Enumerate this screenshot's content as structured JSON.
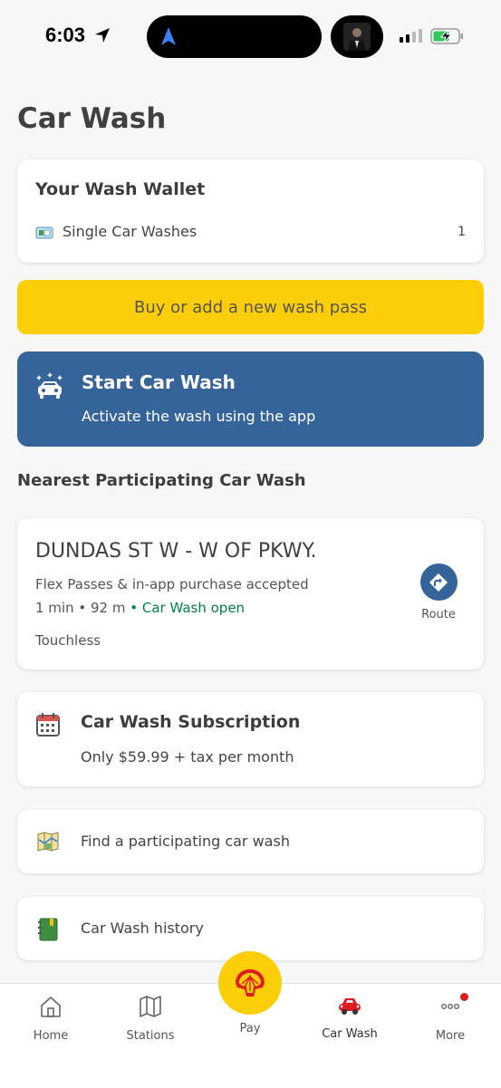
{
  "status_bar": {
    "time": "6:03"
  },
  "page": {
    "title": "Car Wash"
  },
  "wallet": {
    "title": "Your Wash Wallet",
    "item_label": "Single Car Washes",
    "item_count": "1",
    "item_icon": "ticket-icon"
  },
  "buy_button": {
    "label": "Buy or add a new wash pass"
  },
  "start_wash": {
    "title": "Start Car Wash",
    "subtitle": "Activate the wash using the app",
    "icon": "car-sparkle-icon"
  },
  "nearest": {
    "section_title": "Nearest Participating Car Wash",
    "station_name": "DUNDAS ST W - W OF PKWY.",
    "acceptance": "Flex Passes & in-app purchase accepted",
    "time": "1 min",
    "distance": "92 m",
    "status": "Car Wash open",
    "wash_type": "Touchless",
    "route_label": "Route"
  },
  "subscription": {
    "title": "Car Wash Subscription",
    "subtitle": "Only $59.99 + tax per month",
    "icon": "calendar-icon"
  },
  "links": {
    "find": "Find a participating car wash",
    "history": "Car Wash history"
  },
  "bottom_nav": {
    "home": "Home",
    "stations": "Stations",
    "pay": "Pay",
    "car_wash": "Car Wash",
    "more": "More"
  },
  "colors": {
    "brand_yellow": "#fbce07",
    "brand_blue": "#35649a",
    "brand_red": "#dd1d21",
    "open_green": "#008443"
  }
}
